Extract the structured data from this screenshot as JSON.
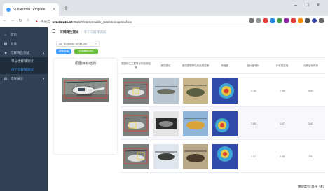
{
  "browser": {
    "tab_title": "Vue Admin Template",
    "address": {
      "security": "不安全",
      "host": "172.21.246.40",
      "path": ":9520/#/interpretable_stat/interexpmachine"
    }
  },
  "sidebar": {
    "items": [
      {
        "label": "首页",
        "icon": "home-icon"
      },
      {
        "label": "总体",
        "icon": "grid-icon"
      },
      {
        "label": "可解释性测试",
        "icon": "test-icon"
      }
    ],
    "subitems": [
      {
        "label": "单分类解释测试",
        "active": false
      },
      {
        "label": "单个可解释测试",
        "active": true
      }
    ],
    "extra_item": {
      "label": "结果展示",
      "icon": "doc-icon"
    }
  },
  "breadcrumb": {
    "first": "可解释性测试",
    "second": "单个可解释测试"
  },
  "model_select": {
    "value": "08_Squeeze-NOM.pth"
  },
  "buttons": {
    "upload": "图像选择",
    "run": "开始解释测试"
  },
  "original": {
    "title": "原图目标检测"
  },
  "table": {
    "headers": [
      "原图标注主要目标的检测结果",
      "遮挡部位",
      "遮挡原图像后的检测结果",
      "热度图",
      "相似度得分",
      "分析度量值",
      "分类后标得分"
    ],
    "rows": [
      {
        "scores": [
          "0.18",
          "7.95",
          "0.00"
        ]
      },
      {
        "scores": [
          "2.89",
          "0.47",
          "2.41"
        ]
      },
      {
        "scores": [
          "2.07",
          "0.95",
          "2.81"
        ]
      }
    ]
  },
  "status": "预测类别:直升飞机"
}
